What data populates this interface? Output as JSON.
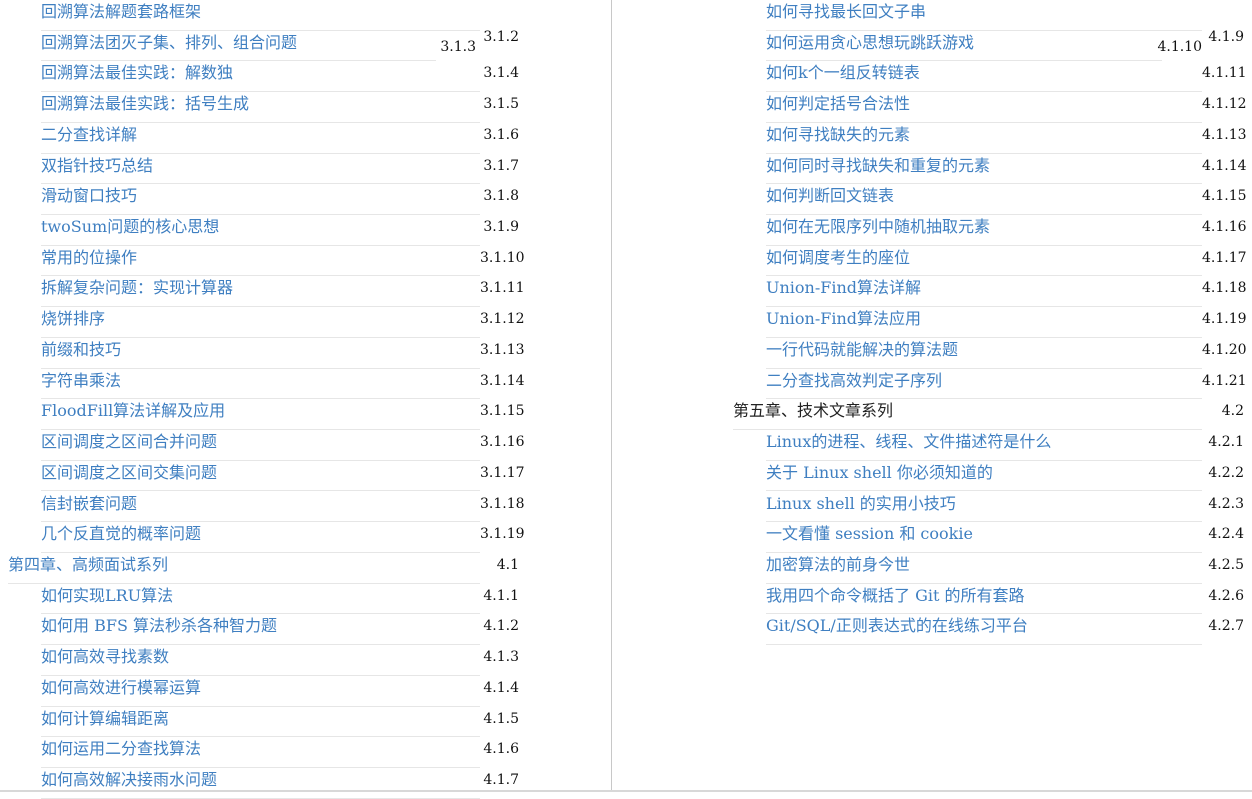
{
  "left_column": [
    {
      "title": "回溯算法解题套路框架",
      "num": "",
      "level": 2
    },
    {
      "title": "回溯算法团灭子集、排列、组合问题",
      "num": "3.1.2",
      "num_alt": "3.1.3",
      "level": 2
    },
    {
      "title": "回溯算法最佳实践：解数独",
      "num": "3.1.4",
      "level": 2
    },
    {
      "title": "回溯算法最佳实践：括号生成",
      "num": "3.1.5",
      "level": 2
    },
    {
      "title": "二分查找详解",
      "num": "3.1.6",
      "level": 2
    },
    {
      "title": "双指针技巧总结",
      "num": "3.1.7",
      "level": 2
    },
    {
      "title": "滑动窗口技巧",
      "num": "3.1.8",
      "level": 2
    },
    {
      "title": "twoSum问题的核心思想",
      "num": "3.1.9",
      "level": 2
    },
    {
      "title": "常用的位操作",
      "num": "3.1.10",
      "level": 2
    },
    {
      "title": "拆解复杂问题：实现计算器",
      "num": "3.1.11",
      "level": 2
    },
    {
      "title": "烧饼排序",
      "num": "3.1.12",
      "level": 2
    },
    {
      "title": "前缀和技巧",
      "num": "3.1.13",
      "level": 2
    },
    {
      "title": "字符串乘法",
      "num": "3.1.14",
      "level": 2
    },
    {
      "title": "FloodFill算法详解及应用",
      "num": "3.1.15",
      "level": 2
    },
    {
      "title": "区间调度之区间合并问题",
      "num": "3.1.16",
      "level": 2
    },
    {
      "title": "区间调度之区间交集问题",
      "num": "3.1.17",
      "level": 2
    },
    {
      "title": "信封嵌套问题",
      "num": "3.1.18",
      "level": 2
    },
    {
      "title": "几个反直觉的概率问题",
      "num": "3.1.19",
      "level": 2
    },
    {
      "title": "第四章、高频面试系列",
      "num": "4.1",
      "level": 1
    },
    {
      "title": "如何实现LRU算法",
      "num": "4.1.1",
      "level": 2
    },
    {
      "title": "如何用 BFS 算法秒杀各种智力题",
      "num": "4.1.2",
      "level": 2
    },
    {
      "title": "如何高效寻找素数",
      "num": "4.1.3",
      "level": 2
    },
    {
      "title": "如何高效进行模幂运算",
      "num": "4.1.4",
      "level": 2
    },
    {
      "title": "如何计算编辑距离",
      "num": "4.1.5",
      "level": 2
    },
    {
      "title": "如何运用二分查找算法",
      "num": "4.1.6",
      "level": 2
    },
    {
      "title": "如何高效解决接雨水问题",
      "num": "4.1.7",
      "level": 2
    }
  ],
  "right_column": [
    {
      "title": "如何寻找最长回文子串",
      "num": "",
      "level": 2
    },
    {
      "title": "如何运用贪心思想玩跳跃游戏",
      "num": "4.1.9",
      "num_alt": "4.1.10",
      "level": 2
    },
    {
      "title": "如何k个一组反转链表",
      "num": "4.1.11",
      "level": 2
    },
    {
      "title": "如何判定括号合法性",
      "num": "4.1.12",
      "level": 2
    },
    {
      "title": "如何寻找缺失的元素",
      "num": "4.1.13",
      "level": 2
    },
    {
      "title": "如何同时寻找缺失和重复的元素",
      "num": "4.1.14",
      "level": 2
    },
    {
      "title": "如何判断回文链表",
      "num": "4.1.15",
      "level": 2
    },
    {
      "title": "如何在无限序列中随机抽取元素",
      "num": "4.1.16",
      "level": 2
    },
    {
      "title": "如何调度考生的座位",
      "num": "4.1.17",
      "level": 2
    },
    {
      "title": "Union-Find算法详解",
      "num": "4.1.18",
      "level": 2
    },
    {
      "title": "Union-Find算法应用",
      "num": "4.1.19",
      "level": 2
    },
    {
      "title": "一行代码就能解决的算法题",
      "num": "4.1.20",
      "level": 2
    },
    {
      "title": "二分查找高效判定子序列",
      "num": "4.1.21",
      "level": 2
    },
    {
      "title": "第五章、技术文章系列",
      "num": "4.2",
      "level": 1,
      "dark": true
    },
    {
      "title": "Linux的进程、线程、文件描述符是什么",
      "num": "4.2.1",
      "level": 2
    },
    {
      "title": "关于 Linux shell 你必须知道的",
      "num": "4.2.2",
      "level": 2
    },
    {
      "title": "Linux shell 的实用小技巧",
      "num": "4.2.3",
      "level": 2
    },
    {
      "title": "一文看懂 session 和 cookie",
      "num": "4.2.4",
      "level": 2
    },
    {
      "title": "加密算法的前身今世",
      "num": "4.2.5",
      "level": 2
    },
    {
      "title": "我用四个命令概括了 Git 的所有套路",
      "num": "4.2.6",
      "level": 2
    },
    {
      "title": "Git/SQL/正则表达式的在线练习平台",
      "num": "4.2.7",
      "level": 2
    }
  ]
}
